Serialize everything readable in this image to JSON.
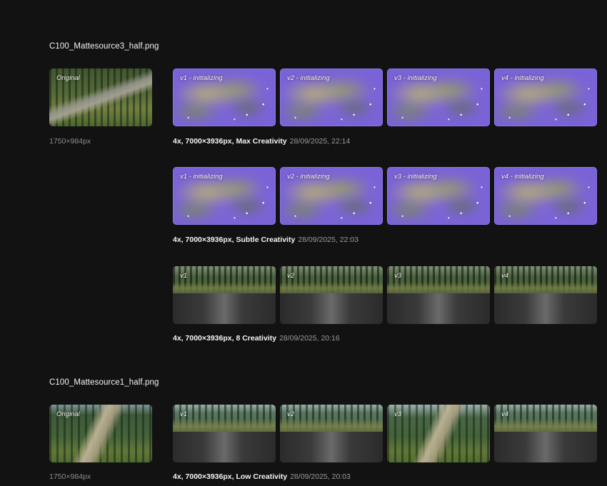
{
  "groups": [
    {
      "filename": "C100_Mattesource3_half.png",
      "original": {
        "label": "Original",
        "dimensions": "1750×984px"
      },
      "batches": [
        {
          "spec": "4x, 7000×3936px, Max Creativity",
          "date": "28/09/2025, 22:14",
          "variants": [
            "v1 - initializing",
            "v2 - initializing",
            "v3 - initializing",
            "v4 - initializing"
          ],
          "state": "initializing"
        },
        {
          "spec": "4x, 7000×3936px, Subtle Creativity",
          "date": "28/09/2025, 22:03",
          "variants": [
            "v1 - initializing",
            "v2 - initializing",
            "v3 - initializing",
            "v4 - initializing"
          ],
          "state": "initializing"
        },
        {
          "spec": "4x, 7000×3936px, 8 Creativity",
          "date": "28/09/2025, 20:16",
          "variants": [
            "v1",
            "v2",
            "v3",
            "v4"
          ],
          "state": "rendering"
        }
      ]
    },
    {
      "filename": "C100_Mattesource1_half.png",
      "original": {
        "label": "Original",
        "dimensions": "1750×984px"
      },
      "batches": [
        {
          "spec": "4x, 7000×3936px, Low Creativity",
          "date": "28/09/2025, 20:03",
          "variants": [
            "v1",
            "v2",
            "v3",
            "v4"
          ],
          "state": "rendering"
        }
      ]
    }
  ],
  "colors": {
    "background": "#121212",
    "initializing": "#7a62d8",
    "text_primary": "#f5f5f5",
    "text_secondary": "#9a9a9a"
  }
}
